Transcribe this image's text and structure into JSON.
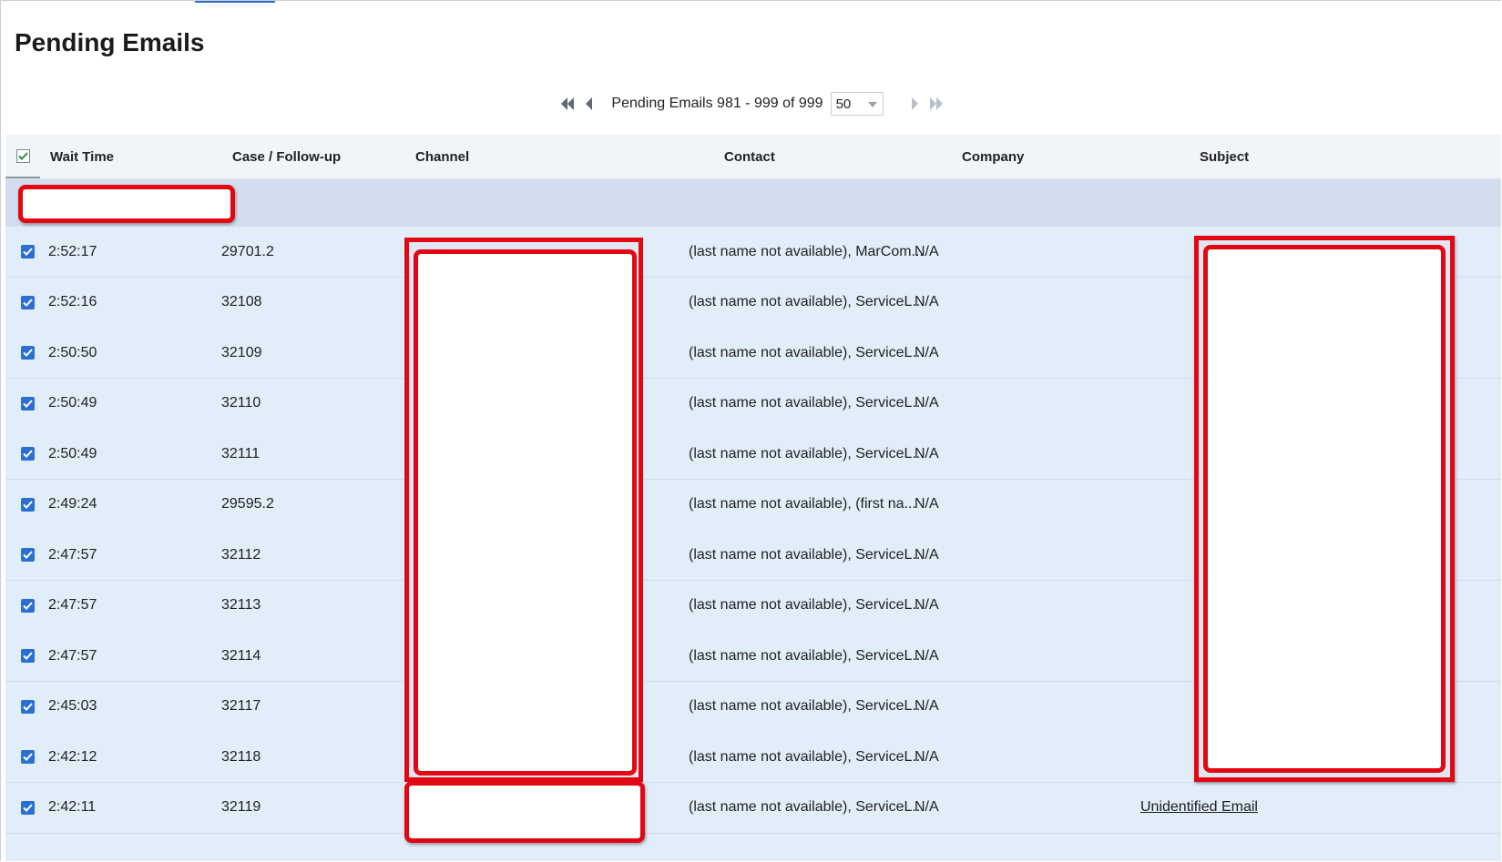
{
  "page": {
    "title": "Pending Emails"
  },
  "pager": {
    "info": "Pending Emails 981 - 999 of 999",
    "page_size": "50"
  },
  "columns": {
    "wait_time": "Wait Time",
    "case": "Case / Follow-up",
    "channel": "Channel",
    "contact": "Contact",
    "company": "Company",
    "subject": "Subject"
  },
  "rows": [
    {
      "wait": "2:52:17",
      "case": "29701.2",
      "contact": "(last name not available), MarCom...",
      "company": "N/A",
      "subject": ""
    },
    {
      "wait": "2:52:16",
      "case": "32108",
      "contact": "(last name not available), ServiceL...",
      "company": "N/A",
      "subject": ""
    },
    {
      "wait": "2:50:50",
      "case": "32109",
      "contact": "(last name not available), ServiceL...",
      "company": "N/A",
      "subject": ""
    },
    {
      "wait": "2:50:49",
      "case": "32110",
      "contact": "(last name not available), ServiceL...",
      "company": "N/A",
      "subject": ""
    },
    {
      "wait": "2:50:49",
      "case": "32111",
      "contact": "(last name not available), ServiceL...",
      "company": "N/A",
      "subject": ""
    },
    {
      "wait": "2:49:24",
      "case": "29595.2",
      "contact": "(last name not available), (first na...",
      "company": "N/A",
      "subject": ""
    },
    {
      "wait": "2:47:57",
      "case": "32112",
      "contact": "(last name not available), ServiceL...",
      "company": "N/A",
      "subject": ""
    },
    {
      "wait": "2:47:57",
      "case": "32113",
      "contact": "(last name not available), ServiceL...",
      "company": "N/A",
      "subject": ""
    },
    {
      "wait": "2:47:57",
      "case": "32114",
      "contact": "(last name not available), ServiceL...",
      "company": "N/A",
      "subject": ""
    },
    {
      "wait": "2:45:03",
      "case": "32117",
      "contact": "(last name not available), ServiceL...",
      "company": "N/A",
      "subject": ""
    },
    {
      "wait": "2:42:12",
      "case": "32118",
      "contact": "(last name not available), ServiceL...",
      "company": "N/A",
      "subject": ""
    },
    {
      "wait": "2:42:11",
      "case": "32119",
      "contact": "(last name not available), ServiceL...",
      "company": "N/A",
      "subject": "Unidentified Email"
    }
  ],
  "icons": {
    "first": "double-chevron-left-icon",
    "prev": "chevron-left-icon",
    "next": "chevron-right-icon",
    "last": "double-chevron-right-icon",
    "dropdown": "caret-down-icon",
    "check": "checkmark-icon"
  },
  "colors": {
    "checkbox": "#2a6fd1",
    "redaction": "#e30613",
    "row_bg": "#e1edf9",
    "filter_bg": "#d2deef"
  }
}
